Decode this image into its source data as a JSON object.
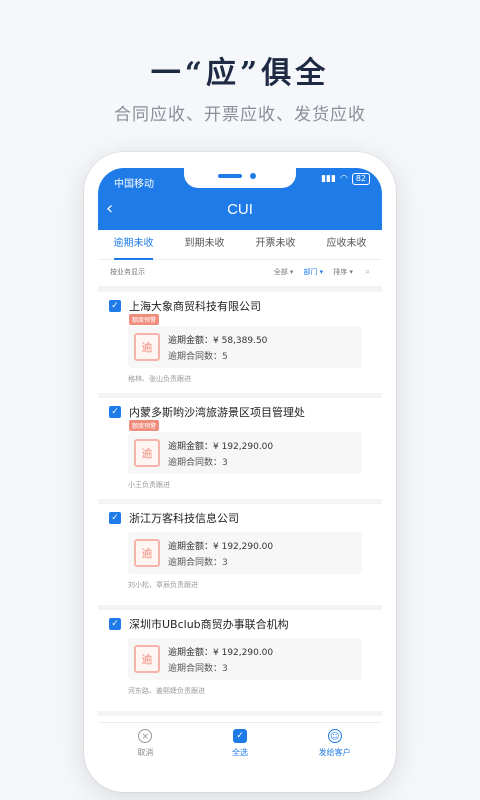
{
  "promo": {
    "headline": "一“应”俱全",
    "subline": "合同应收、开票应收、发货应收"
  },
  "status_bar": {
    "carrier": "中国移动",
    "battery": "82"
  },
  "header": {
    "title": "CUI"
  },
  "tabs": [
    {
      "label": "逾期未收",
      "active": true
    },
    {
      "label": "到期未收",
      "active": false
    },
    {
      "label": "开票未收",
      "active": false
    },
    {
      "label": "应收未收",
      "active": false
    }
  ],
  "filters": {
    "left_label": "按业务显示",
    "all": "全部 ▾",
    "department": "部门 ▾",
    "sort": "排序 ▾"
  },
  "items": [
    {
      "company": "上海大象商贸科技有限公司",
      "badge": "额度预警",
      "amount_label": "逾期金额：",
      "amount": "¥ 58,389.50",
      "count_label": "逾期合同数：",
      "count": "5",
      "followers": "格林、张山负责跟进"
    },
    {
      "company": "内蒙多斯哟沙湾旅游景区项目管理处",
      "badge": "额度预警",
      "amount_label": "逾期金额：",
      "amount": "¥ 192,290.00",
      "count_label": "逾期合同数：",
      "count": "3",
      "followers": "小王负责跟进"
    },
    {
      "company": "浙江万客科技信息公司",
      "badge": "",
      "amount_label": "逾期金额：",
      "amount": "¥ 192,290.00",
      "count_label": "逾期合同数：",
      "count": "3",
      "followers": "刘小松、章辰负责跟进"
    },
    {
      "company": "深圳市UBclub商贸办事联合机构",
      "badge": "",
      "amount_label": "逾期金额：",
      "amount": "¥ 192,290.00",
      "count_label": "逾期合同数：",
      "count": "3",
      "followers": "河东路、姜熙婕负责跟进"
    }
  ],
  "overdue_icon_char": "逾",
  "bottom_bar": {
    "cancel": "取消",
    "select_all": "全选",
    "send": "发给客户"
  },
  "colors": {
    "accent": "#1e7be8",
    "warning": "#f08c7c"
  }
}
